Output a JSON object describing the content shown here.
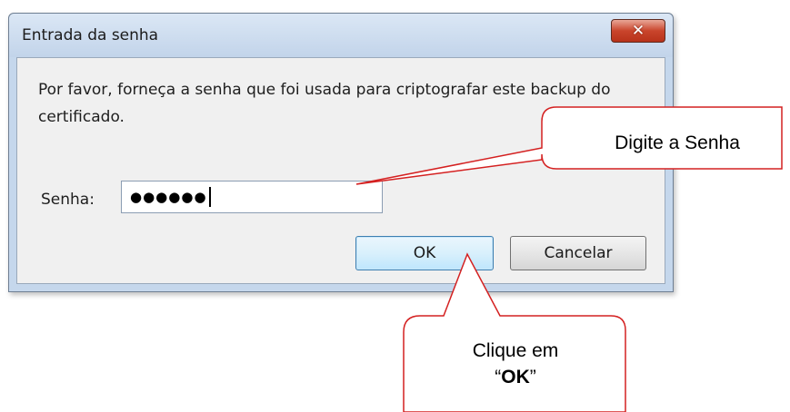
{
  "window": {
    "title": "Entrada da senha",
    "close_symbol": "✕"
  },
  "dialog": {
    "message": "Por favor, forneça a senha que foi usada para criptografar este backup do certificado.",
    "password_label": "Senha:",
    "password_value": "●●●●●●",
    "ok_label": "OK",
    "cancel_label": "Cancelar"
  },
  "callouts": {
    "password_hint": "Digite a Senha",
    "ok_hint_prefix": "Clique em",
    "ok_hint_open_quote": "“",
    "ok_hint_bold": "OK",
    "ok_hint_close_quote": "”"
  },
  "colors": {
    "callout_border": "#d42020",
    "ok_button_border": "#3c7fb1",
    "close_button": "#c9452c"
  }
}
